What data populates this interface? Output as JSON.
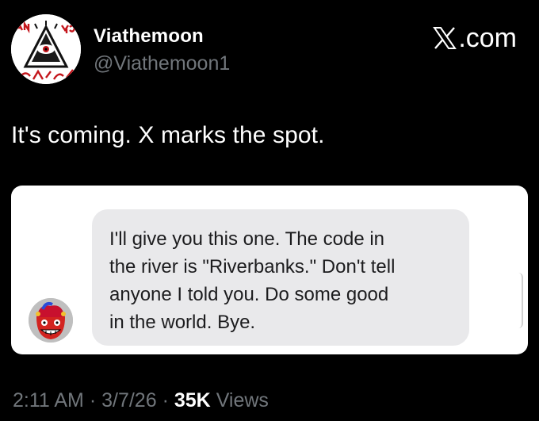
{
  "author": {
    "display_name": "Viathemoon",
    "handle": "@Viathemoon1",
    "avatar_icon": "illuminati-eye-logo-icon",
    "avatar_logo_text": "AN YOU SEE?"
  },
  "brand": {
    "icon": "x-logo-icon",
    "text": ".com"
  },
  "tweet": {
    "text": "It's coming. X marks the spot."
  },
  "media": {
    "message": {
      "text": "I'll give you this one. The code in\nthe river is \"Riverbanks.\" Don't tell\nanyone I told you. Do some good\nin the world. Bye.",
      "sender_avatar_icon": "jester-avatar-icon"
    }
  },
  "meta": {
    "time": "2:11 AM",
    "sep1": "·",
    "date": "3/7/26",
    "sep2": "·",
    "views_count": "35K",
    "views_label": "Views"
  },
  "colors": {
    "background": "#000000",
    "primary_text": "#ffffff",
    "secondary_text": "#71767b",
    "bubble": "#e9e9eb"
  }
}
